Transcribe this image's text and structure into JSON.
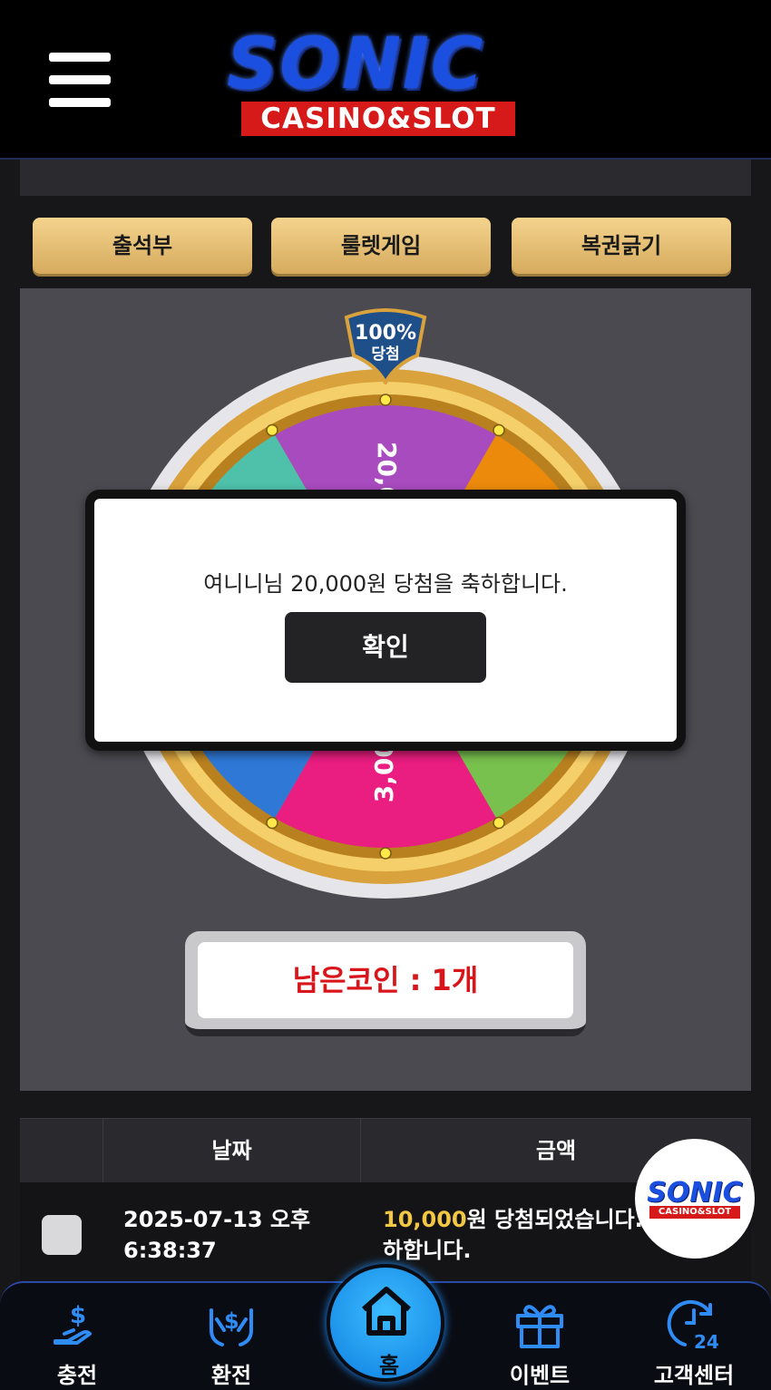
{
  "header": {
    "logo_main": "SONIC",
    "logo_sub": "CASINO&SLOT"
  },
  "tabs": [
    {
      "label": "출석부"
    },
    {
      "label": "룰렛게임"
    },
    {
      "label": "복권긁기"
    }
  ],
  "wheel": {
    "badge_top": "100%",
    "badge_bottom": "당첨",
    "segment_labels": [
      "20,000",
      "3,000"
    ],
    "segment_colors": [
      "#a84bbf",
      "#ec8a0b",
      "#78c14f",
      "#ea1d80",
      "#2f78d6",
      "#4fc1aa"
    ]
  },
  "modal": {
    "message": "여니니님 20,000원 당첨을 축하합니다.",
    "ok_label": "확인"
  },
  "coins": {
    "label": "남은코인 : 1개"
  },
  "history": {
    "headers": [
      "날짜",
      "금액"
    ],
    "rows": [
      {
        "date": "2025-07-13 오후 6:38:37",
        "amount": "10,000",
        "amount_suffix": "원 당첨되었습니다. 축하합니다."
      }
    ]
  },
  "float_logo": {
    "main": "SONIC",
    "sub": "CASINO&SLOT"
  },
  "nav": {
    "items": [
      {
        "label": "충전",
        "icon": "deposit-icon"
      },
      {
        "label": "환전",
        "icon": "withdraw-icon"
      },
      {
        "label": "홈",
        "icon": "home-icon"
      },
      {
        "label": "이벤트",
        "icon": "gift-icon"
      },
      {
        "label": "고객센터",
        "icon": "support-24-icon"
      }
    ]
  }
}
